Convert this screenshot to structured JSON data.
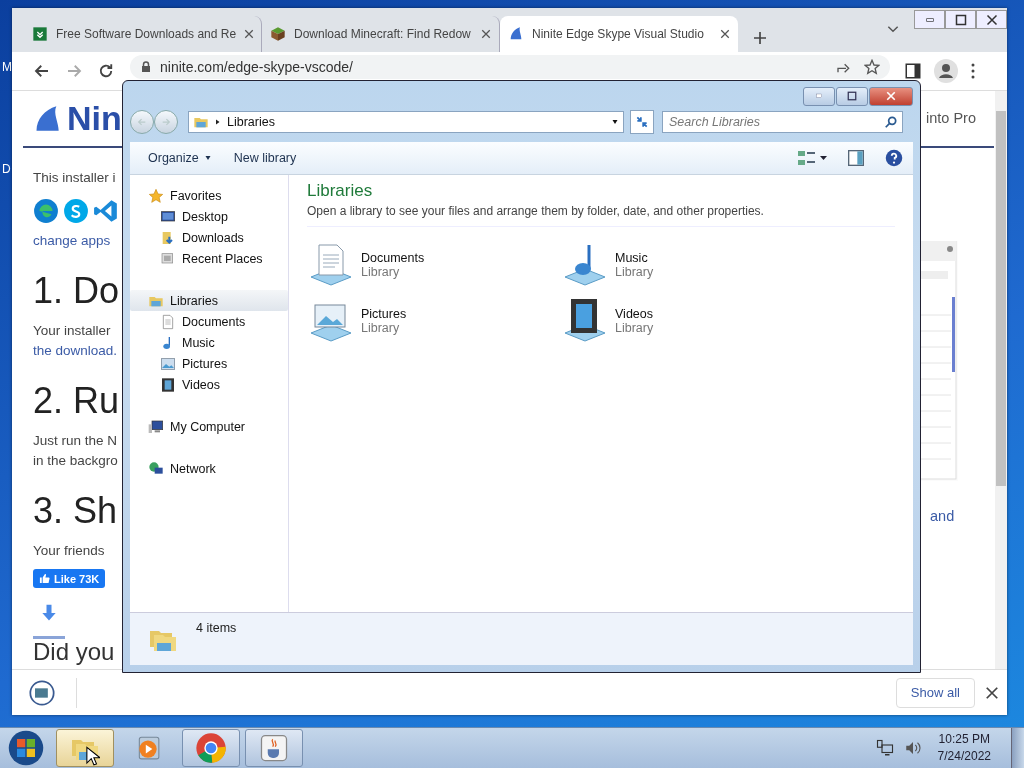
{
  "desktop": {
    "icon_labels": [
      "M",
      "D"
    ]
  },
  "browser": {
    "tabs": [
      {
        "title": "Free Software Downloads and Re",
        "kind": "softpedia",
        "selected": false
      },
      {
        "title": "Download Minecraft: Find Redow",
        "kind": "minecraft",
        "selected": false
      },
      {
        "title": "Ninite Edge Skype Visual Studio",
        "kind": "ninite",
        "selected": true
      }
    ],
    "url": "ninite.com/edge-skype-vscode/",
    "page": {
      "logo_text": "Nin",
      "header_link": "into Pro",
      "left": [
        {
          "kind": "text",
          "text": "This installer i"
        },
        {
          "kind": "app_icons"
        },
        {
          "kind": "link",
          "text": "change apps"
        },
        {
          "kind": "heading",
          "text": "1. Do"
        },
        {
          "kind": "text",
          "text": "Your installer"
        },
        {
          "kind": "link",
          "text": "the download."
        },
        {
          "kind": "heading",
          "text": "2. Ru"
        },
        {
          "kind": "text",
          "text": "Just run the N"
        },
        {
          "kind": "text",
          "text": "in the backgro"
        },
        {
          "kind": "heading",
          "text": "3. Sh"
        },
        {
          "kind": "text",
          "text": "Your friends"
        },
        {
          "kind": "like",
          "text": "Like 73K"
        },
        {
          "kind": "arrow"
        },
        {
          "kind": "subheading",
          "text": "Did you"
        }
      ],
      "right_link": "and"
    },
    "download_bar": {
      "show_all": "Show all"
    }
  },
  "explorer": {
    "address": [
      "Libraries"
    ],
    "search": {
      "placeholder": "Search Libraries"
    },
    "commands": [
      {
        "label": "Organize",
        "dropdown": true
      },
      {
        "label": "New library",
        "dropdown": false
      }
    ],
    "nav": [
      {
        "label": "Favorites",
        "kind": "star",
        "selected": false,
        "children": [
          {
            "label": "Desktop",
            "kind": "desktop",
            "selected": false
          },
          {
            "label": "Downloads",
            "kind": "downloads",
            "selected": false
          },
          {
            "label": "Recent Places",
            "kind": "recent",
            "selected": false
          }
        ]
      },
      {
        "label": "Libraries",
        "kind": "library",
        "selected": true,
        "children": [
          {
            "label": "Documents",
            "kind": "documents",
            "selected": false
          },
          {
            "label": "Music",
            "kind": "music",
            "selected": false
          },
          {
            "label": "Pictures",
            "kind": "pictures",
            "selected": false
          },
          {
            "label": "Videos",
            "kind": "videos",
            "selected": false
          }
        ]
      },
      {
        "label": "My Computer",
        "kind": "computer",
        "selected": false
      },
      {
        "label": "Network",
        "kind": "network",
        "selected": false
      }
    ],
    "heading": "Libraries",
    "description": "Open a library to see your files and arrange them by folder, date, and other properties.",
    "items": [
      {
        "name": "Documents",
        "type": "Library",
        "kind": "documents"
      },
      {
        "name": "Music",
        "type": "Library",
        "kind": "music"
      },
      {
        "name": "Pictures",
        "type": "Library",
        "kind": "pictures"
      },
      {
        "name": "Videos",
        "type": "Library",
        "kind": "videos"
      }
    ],
    "status": "4 items"
  },
  "taskbar": {
    "buttons": [
      {
        "kind": "explorer",
        "running": true,
        "selected": true
      },
      {
        "kind": "media",
        "running": false,
        "selected": false
      },
      {
        "kind": "chrome",
        "running": true,
        "selected": false
      },
      {
        "kind": "java",
        "running": true,
        "selected": false
      }
    ],
    "time": "10:25 PM",
    "date": "7/24/2022"
  }
}
